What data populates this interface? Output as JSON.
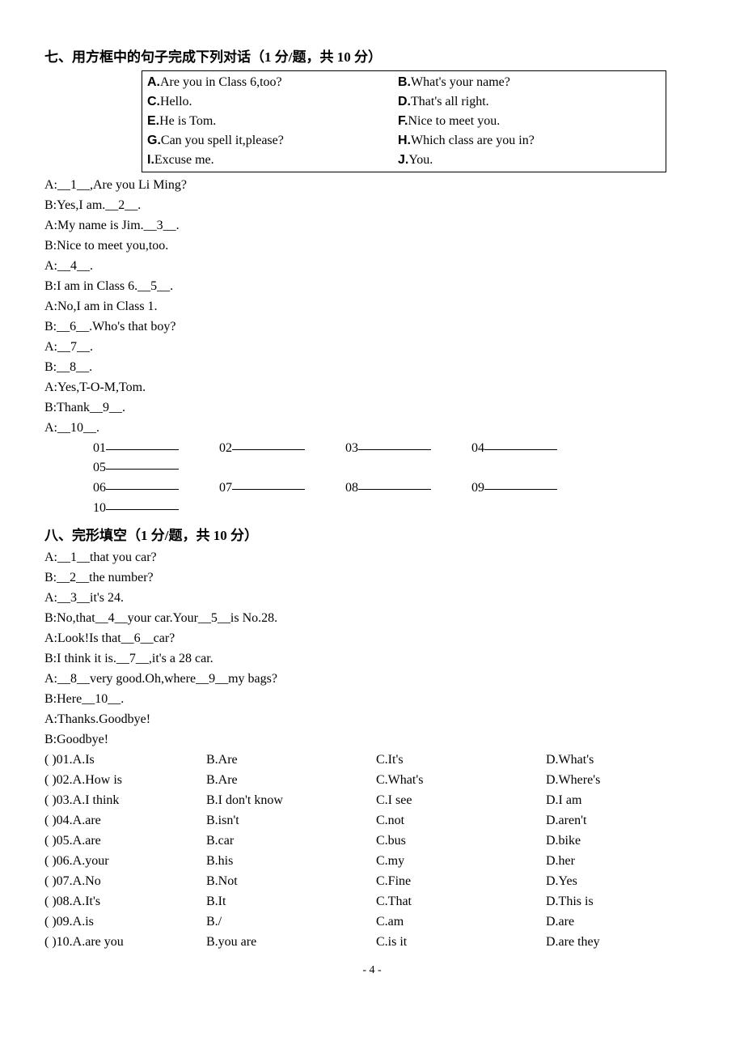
{
  "section7": {
    "heading": "七、用方框中的句子完成下列对话（1 分/题，共 10 分）",
    "box": {
      "A": "Are you in Class 6,too?",
      "B": "What's your name?",
      "C": "Hello.",
      "D": "That's all right.",
      "E": "He is Tom.",
      "F": "Nice to meet you.",
      "G": "Can you spell it,please?",
      "H": "Which class are you in?",
      "I": "Excuse me.",
      "J": "You."
    },
    "dialog": [
      "A:__1__,Are you Li Ming?",
      "B:Yes,I am.__2__.",
      "A:My name is Jim.__3__.",
      "B:Nice to meet you,too.",
      "A:__4__.",
      "B:I am in Class 6.__5__.",
      "A:No,I am in Class 1.",
      "B:__6__.Who's that boy?",
      "A:__7__.",
      "B:__8__.",
      "A:Yes,T-O-M,Tom.",
      "B:Thank__9__.",
      "A:__10__."
    ],
    "answerLabels": [
      "01",
      "02",
      "03",
      "04",
      "05",
      "06",
      "07",
      "08",
      "09",
      "10"
    ]
  },
  "section8": {
    "heading": "八、完形填空（1 分/题，共 10 分）",
    "dialog": [
      "A:__1__that you car?",
      "B:__2__the number?",
      "A:__3__it's 24.",
      "B:No,that__4__your car.Your__5__is No.28.",
      "A:Look!Is that__6__car?",
      "B:I think it is.__7__,it's a 28 car.",
      "A:__8__very good.Oh,where__9__my bags?",
      "B:Here__10__.",
      "A:Thanks.Goodbye!",
      "B:Goodbye!"
    ],
    "options": [
      {
        "n": "01",
        "A": "Is",
        "B": "Are",
        "C": "It's",
        "D": "What's"
      },
      {
        "n": "02",
        "A": "How is",
        "B": "Are",
        "C": "What's",
        "D": "Where's"
      },
      {
        "n": "03",
        "A": "I think",
        "B": "I don't know",
        "C": "I see",
        "D": "I am"
      },
      {
        "n": "04",
        "A": "are",
        "B": "isn't",
        "C": "not",
        "D": "aren't"
      },
      {
        "n": "05",
        "A": "are",
        "B": "car",
        "C": "bus",
        "D": "bike"
      },
      {
        "n": "06",
        "A": "your",
        "B": "his",
        "C": "my",
        "D": "her"
      },
      {
        "n": "07",
        "A": "No",
        "B": "Not",
        "C": "Fine",
        "D": "Yes"
      },
      {
        "n": "08",
        "A": "It's",
        "B": "It",
        "C": "That",
        "D": "This is"
      },
      {
        "n": "09",
        "A": "is",
        "B": "/",
        "C": "am",
        "D": "are"
      },
      {
        "n": "10",
        "A": "are you",
        "B": "you are",
        "C": "is it",
        "D": "are they"
      }
    ]
  },
  "pageNumber": "- 4 -"
}
